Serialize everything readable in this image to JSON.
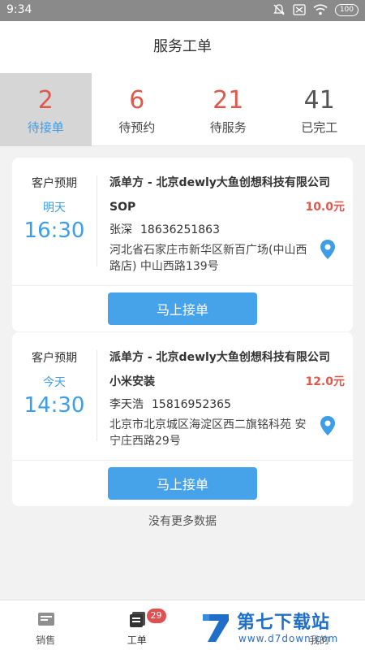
{
  "status_bar": {
    "time": "9:34",
    "battery": "100"
  },
  "header": {
    "title": "服务工单"
  },
  "tabs": [
    {
      "count": "2",
      "label": "待接单",
      "count_color": "#e0584b",
      "active": true
    },
    {
      "count": "6",
      "label": "待预约",
      "count_color": "#e0584b"
    },
    {
      "count": "21",
      "label": "待服务",
      "count_color": "#e0584b"
    },
    {
      "count": "41",
      "label": "已完工",
      "count_color": "#555555"
    }
  ],
  "orders": [
    {
      "expect_label": "客户预期",
      "day": "明天",
      "time": "16:30",
      "dispatcher": "派单方 - 北京dewly大鱼创想科技有限公司",
      "service": "SOP",
      "price": "10.0元",
      "contact_name": "张深",
      "phone": "18636251863",
      "address": "河北省石家庄市新华区新百广场(中山西路店) 中山西路139号",
      "action": "马上接单"
    },
    {
      "expect_label": "客户预期",
      "day": "今天",
      "time": "14:30",
      "dispatcher": "派单方 - 北京dewly大鱼创想科技有限公司",
      "service": "小米安装",
      "price": "12.0元",
      "contact_name": "李天浩",
      "phone": "15816952365",
      "address": "北京市北京城区海淀区西二旗铭科苑 安宁庄西路29号",
      "action": "马上接单"
    }
  ],
  "footer_text": "没有更多数据",
  "bottom_nav": [
    {
      "label": "销售",
      "icon": "sales-icon"
    },
    {
      "label": "工单",
      "icon": "work-order-icon",
      "badge": "29"
    },
    {
      "label": "",
      "icon": ""
    },
    {
      "label": "我的",
      "icon": "profile-icon"
    }
  ],
  "watermark": {
    "cn": "第七下载站",
    "url": "www.d7down.com"
  },
  "colors": {
    "accent": "#3d9de8",
    "price": "#e0584b",
    "button": "#46a3ea",
    "badge": "#e05050"
  }
}
